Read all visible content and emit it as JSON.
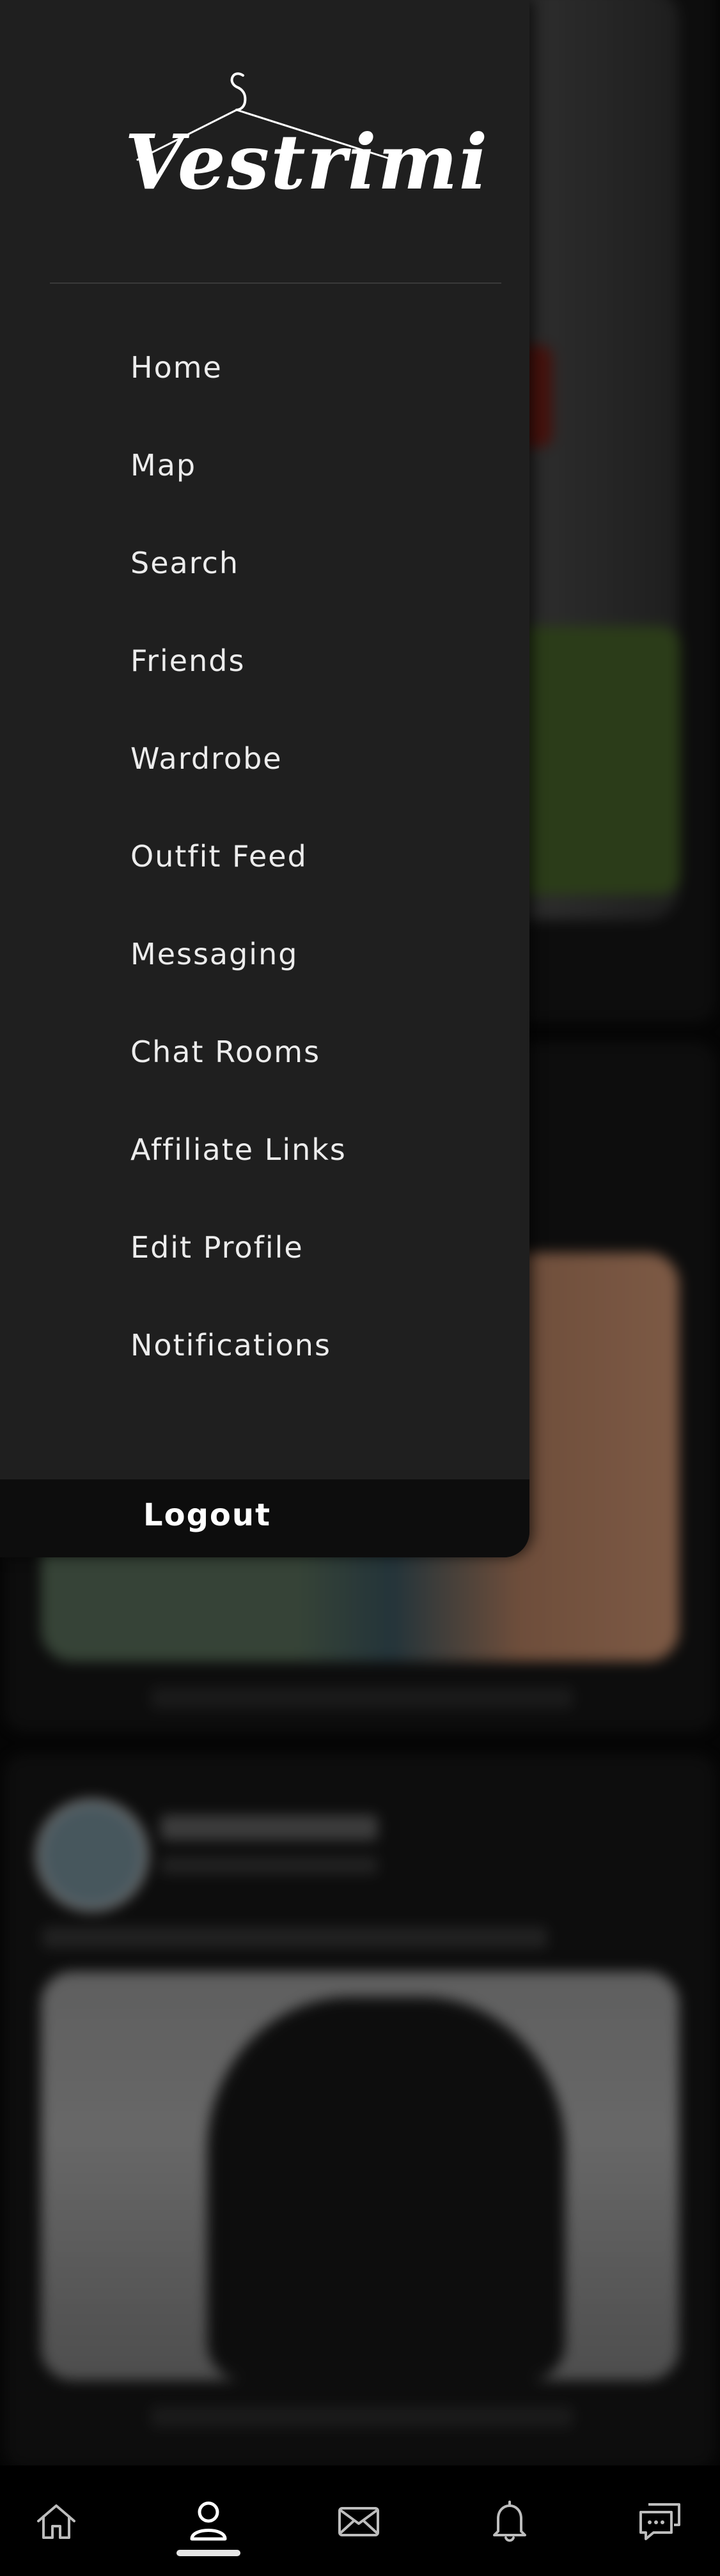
{
  "app": {
    "logo_text": "Vestrimi"
  },
  "drawer": {
    "menu_items": [
      {
        "label": "Home"
      },
      {
        "label": "Map"
      },
      {
        "label": "Search"
      },
      {
        "label": "Friends"
      },
      {
        "label": "Wardrobe"
      },
      {
        "label": "Outfit Feed"
      },
      {
        "label": "Messaging"
      },
      {
        "label": "Chat Rooms"
      },
      {
        "label": "Affiliate Links"
      },
      {
        "label": "Edit Profile"
      },
      {
        "label": "Notifications"
      }
    ],
    "logout_label": "Logout"
  },
  "bottom_nav": {
    "items": [
      {
        "icon": "home-icon"
      },
      {
        "icon": "profile-icon",
        "active": true
      },
      {
        "icon": "mail-icon"
      },
      {
        "icon": "bell-icon"
      },
      {
        "icon": "chat-icon"
      }
    ]
  },
  "colors": {
    "drawer_bg": "#1f1f1f",
    "logout_bg": "#0d0d0d",
    "text": "#ececec",
    "nav_icon": "#bdbdbd",
    "nav_active": "#ffffff"
  }
}
